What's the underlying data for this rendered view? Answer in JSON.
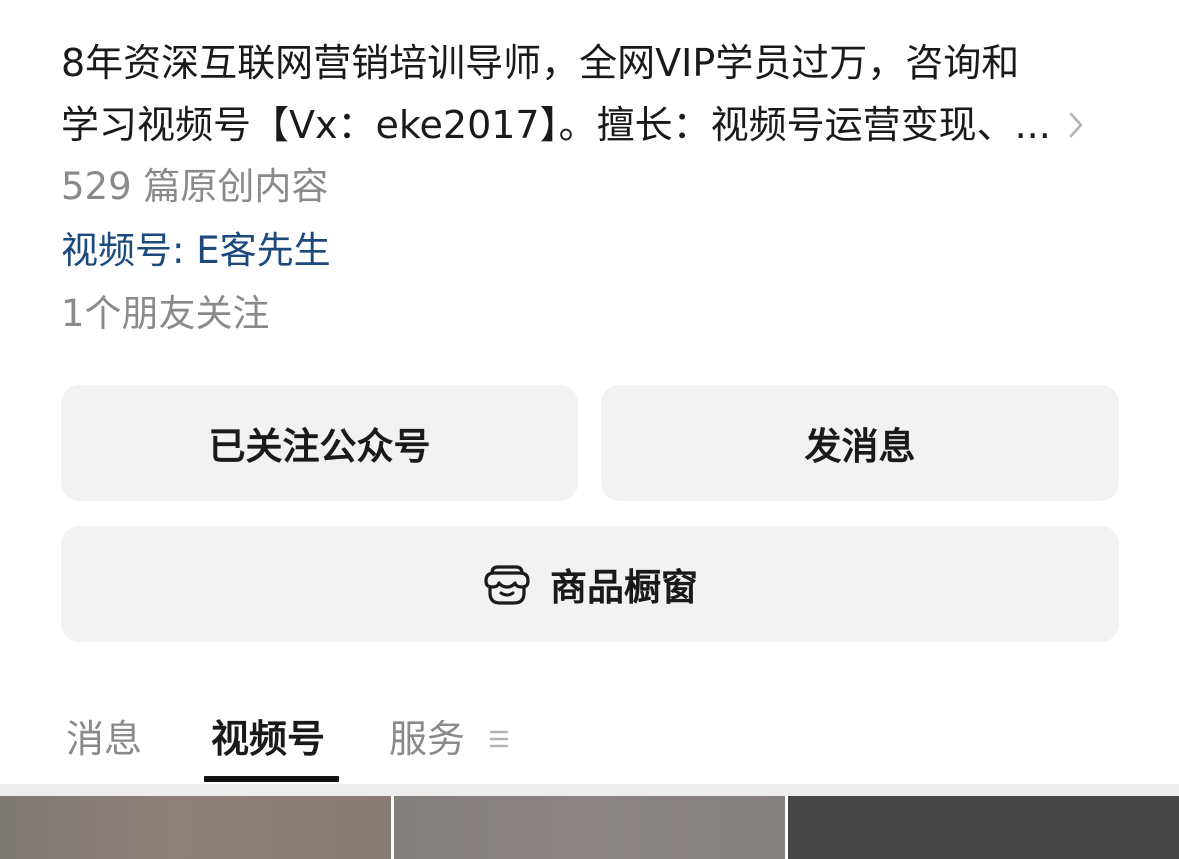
{
  "profile": {
    "bio_line1": "8年资深互联网营销培训导师，全网VIP学员过万，咨询和",
    "bio_line2": "学习视频号【Vx：eke2017】。擅长：视频号运营变现、...",
    "article_count": "529 篇原创内容",
    "channel_link": "视频号: E客先生",
    "friends_following": "1个朋友关注"
  },
  "actions": {
    "follow_label": "已关注公众号",
    "message_label": "发消息",
    "shop_label": "商品橱窗",
    "shop_icon": "storefront-icon"
  },
  "tabs": [
    {
      "label": "消息",
      "active": false
    },
    {
      "label": "视频号",
      "active": true
    },
    {
      "label": "服务",
      "active": false
    }
  ],
  "icons": {
    "bio_more": "chevron-right-icon",
    "service_menu": "menu-icon"
  },
  "colors": {
    "link": "#1d4a7d",
    "secondary_text": "#8a8a8a",
    "button_bg": "#f2f2f2",
    "thumb1": "#8a7f79",
    "thumb2": "#858080",
    "thumb3": "#464646"
  }
}
